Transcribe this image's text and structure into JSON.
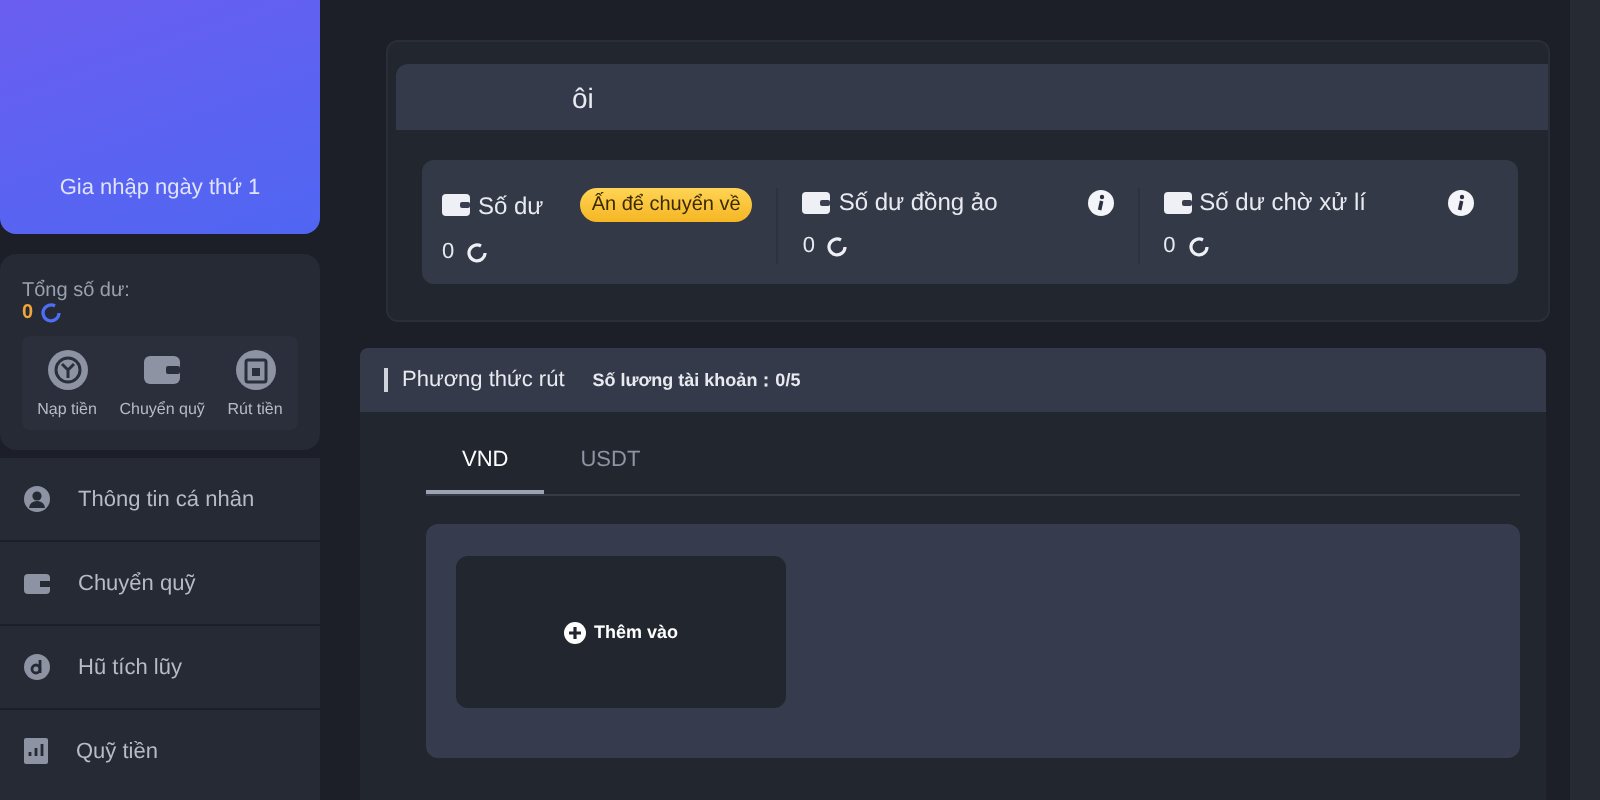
{
  "sidebar": {
    "member_card": {
      "join_text": "Gia nhập ngày thứ 1"
    },
    "total_balance": {
      "label": "Tổng số dư:",
      "value": "0"
    },
    "actions": [
      {
        "kind": "deposit",
        "label": "Nạp tiền"
      },
      {
        "kind": "transfer",
        "label": "Chuyển quỹ"
      },
      {
        "kind": "withdraw",
        "label": "Rút tiền"
      }
    ],
    "menu": [
      {
        "kind": "user",
        "label": "Thông tin cá nhân"
      },
      {
        "kind": "wallet",
        "label": "Chuyển quỹ"
      },
      {
        "kind": "coin",
        "label": "Hũ tích lũy"
      },
      {
        "kind": "fund",
        "label": "Quỹ tiền"
      }
    ]
  },
  "wallet": {
    "title": "ôi",
    "balances": [
      {
        "label": "Số dư",
        "value": "0",
        "badge": "Ấn để chuyển về",
        "info": false
      },
      {
        "label": "Số dư đồng ảo",
        "value": "0",
        "info": true
      },
      {
        "label": "Số dư chờ xử lí",
        "value": "0",
        "info": true
      }
    ]
  },
  "withdraw": {
    "title": "Phương thức rút",
    "account_count": "Số lương tài khoản：0/5",
    "tabs": [
      {
        "label": "VND",
        "selected": true
      },
      {
        "label": "USDT",
        "selected": false
      }
    ],
    "add_button": "Thêm vào"
  }
}
